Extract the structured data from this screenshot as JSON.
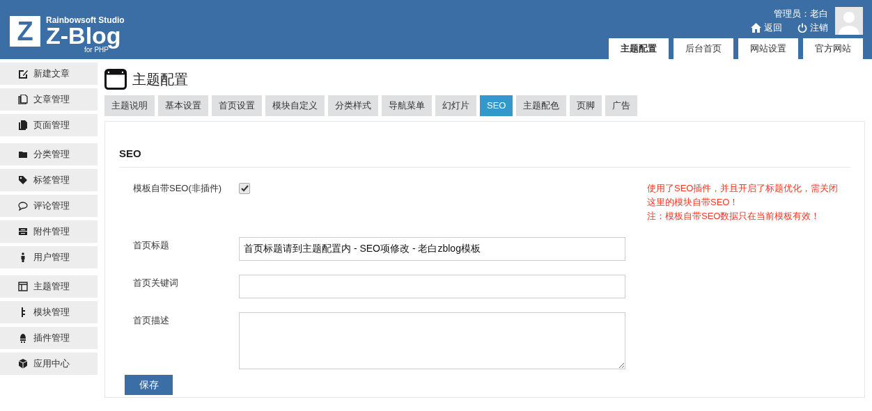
{
  "header": {
    "logo": {
      "studio": "Rainbowsoft Studio",
      "mark": "Z",
      "name": "Z-Blog",
      "sub": "for PHP"
    },
    "user": "管理员：老白",
    "links": [
      {
        "label": "返回"
      },
      {
        "label": "注销"
      }
    ],
    "nav": [
      {
        "label": "主题配置",
        "selected": true
      },
      {
        "label": "后台首页",
        "selected": false
      },
      {
        "label": "网站设置",
        "selected": false
      },
      {
        "label": "官方网站",
        "selected": false
      }
    ]
  },
  "sidebar": {
    "groups": [
      {
        "items": [
          {
            "label": "新建文章"
          },
          {
            "label": "文章管理"
          },
          {
            "label": "页面管理"
          }
        ]
      },
      {
        "items": [
          {
            "label": "分类管理"
          },
          {
            "label": "标签管理"
          },
          {
            "label": "评论管理"
          },
          {
            "label": "附件管理"
          },
          {
            "label": "用户管理"
          }
        ]
      },
      {
        "items": [
          {
            "label": "主题管理"
          },
          {
            "label": "模块管理"
          },
          {
            "label": "插件管理"
          },
          {
            "label": "应用中心"
          }
        ]
      }
    ]
  },
  "page": {
    "title": "主题配置",
    "tabs": [
      {
        "label": "主题说明",
        "selected": false
      },
      {
        "label": "基本设置",
        "selected": false
      },
      {
        "label": "首页设置",
        "selected": false
      },
      {
        "label": "模块自定义",
        "selected": false
      },
      {
        "label": "分类样式",
        "selected": false
      },
      {
        "label": "导航菜单",
        "selected": false
      },
      {
        "label": "幻灯片",
        "selected": false
      },
      {
        "label": "SEO",
        "selected": true
      },
      {
        "label": "主题配色",
        "selected": false
      },
      {
        "label": "页脚",
        "selected": false
      },
      {
        "label": "广告",
        "selected": false
      }
    ],
    "section": "SEO",
    "fields": [
      {
        "kind": "checkbox",
        "label": "模板自带SEO(非插件)",
        "checked": true
      },
      {
        "kind": "text",
        "label": "首页标题",
        "value": "首页标题请到主题配置内 - SEO项修改 - 老白zblog模板"
      },
      {
        "kind": "text",
        "label": "首页关键词"
      },
      {
        "kind": "textarea",
        "label": "首页描述"
      }
    ],
    "notes": [
      "使用了SEO插件，并且开启了标题优化，需关闭这里的模块自带SEO！",
      "注：模板自带SEO数据只在当前模板有效！"
    ],
    "save": "保存"
  }
}
